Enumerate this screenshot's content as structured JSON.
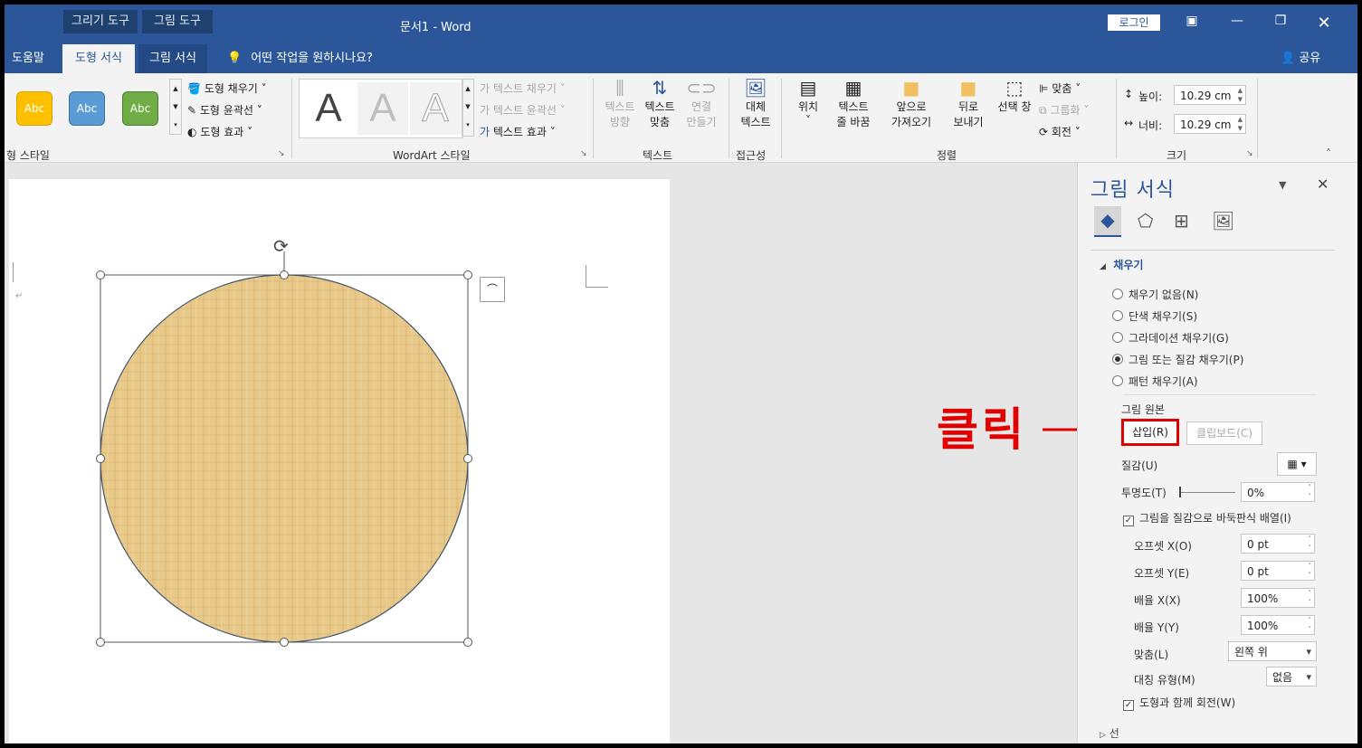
{
  "window": {
    "context_tab_1": "그리기 도구",
    "context_tab_2": "그림 도구",
    "title": "문서1  -  Word",
    "login": "로그인",
    "share": "공유"
  },
  "tabs": {
    "help": "도움말",
    "shape_format": "도형 서식",
    "picture_format": "그림 서식",
    "tell_me": "어떤 작업을 원하시나요?"
  },
  "ribbon": {
    "abc": "Abc",
    "shape_fill": "도형 채우기",
    "shape_outline": "도형 윤곽선",
    "shape_effects": "도형 효과",
    "group_shape_styles": "형 스타일",
    "wordart_letter": "A",
    "text_fill": "텍스트 채우기",
    "text_outline": "텍스트 윤곽선",
    "text_effects": "텍스트 효과",
    "group_wordart": "WordArt 스타일",
    "text_direction_1": "텍스트",
    "text_direction_2": "방향",
    "align_text_1": "텍스트",
    "align_text_2": "맞춤",
    "create_link_1": "연결",
    "create_link_2": "만들기",
    "group_text": "텍스트",
    "alt_text_1": "대체",
    "alt_text_2": "텍스트",
    "group_accessibility": "접근성",
    "position": "위치",
    "wrap_text_1": "텍스트",
    "wrap_text_2": "줄 바꿈",
    "bring_forward_1": "앞으로",
    "bring_forward_2": "가져오기",
    "send_backward_1": "뒤로",
    "send_backward_2": "보내기",
    "selection_pane": "선택 창",
    "align": "맞춤",
    "group": "그룹화",
    "rotate": "회전",
    "group_arrange": "정렬",
    "height_label": "높이:",
    "height_value": "10.29 cm",
    "width_label": "너비:",
    "width_value": "10.29 cm",
    "group_size": "크기"
  },
  "pane": {
    "title": "그림 서식",
    "fill_header": "채우기",
    "fill_options": [
      {
        "label": "채우기 없음(N)",
        "selected": false
      },
      {
        "label": "단색 채우기(S)",
        "selected": false
      },
      {
        "label": "그라데이션 채우기(G)",
        "selected": false
      },
      {
        "label": "그림 또는 질감 채우기(P)",
        "selected": true
      },
      {
        "label": "패턴 채우기(A)",
        "selected": false
      }
    ],
    "picture_source": "그림 원본",
    "insert_button": "삽입(R)",
    "clipboard_button": "클립보드(C)",
    "texture_label": "질감(U)",
    "transparency_label": "투명도(T)",
    "transparency_value": "0%",
    "tile_label": "그림을 질감으로 바둑판식 배열(I)",
    "tile_checked": true,
    "offset_x_label": "오프셋 X(O)",
    "offset_x_value": "0 pt",
    "offset_y_label": "오프셋 Y(E)",
    "offset_y_value": "0 pt",
    "scale_x_label": "배율 X(X)",
    "scale_x_value": "100%",
    "scale_y_label": "배율 Y(Y)",
    "scale_y_value": "100%",
    "alignment_label": "맞춤(L)",
    "alignment_value": "왼쪽 위",
    "mirror_label": "대칭 유형(M)",
    "mirror_value": "없음",
    "rotate_with_shape_label": "도형과 함께 회전(W)",
    "rotate_with_shape_checked": true,
    "line_header": "선"
  },
  "annotation": {
    "callout": "클릭"
  },
  "colors": {
    "word_blue": "#2b579a",
    "abc_orange": "#ffc000",
    "abc_blue": "#5b9bd5",
    "abc_green": "#70ad47",
    "annotation_red": "#e00000",
    "texture": "#e8c98a"
  }
}
